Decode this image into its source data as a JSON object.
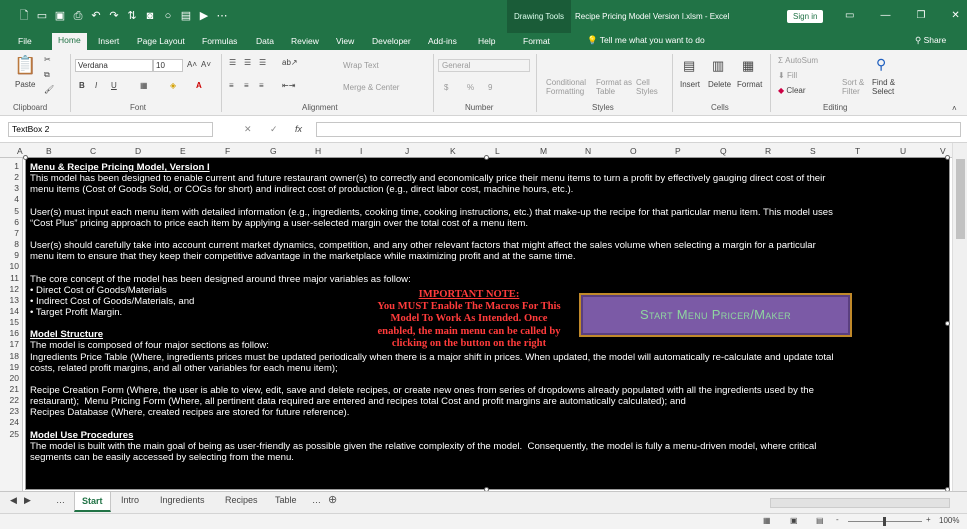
{
  "titlebar": {
    "drawing_tools": "Drawing Tools",
    "doc_title": "Recipe Pricing Model Version I.xlsm  -  Excel",
    "sign_in": "Sign in"
  },
  "tabs": [
    "File",
    "Home",
    "Insert",
    "Page Layout",
    "Formulas",
    "Data",
    "Review",
    "View",
    "Developer",
    "Add-ins",
    "Help",
    "Format"
  ],
  "tell_me": "Tell me what you want to do",
  "share": "Share",
  "ribbon": {
    "clipboard": {
      "paste": "Paste",
      "label": "Clipboard"
    },
    "font": {
      "name": "Verdana",
      "size": "10",
      "label": "Font",
      "bold": "B",
      "italic": "I",
      "underline": "U"
    },
    "alignment": {
      "wrap": "Wrap Text",
      "merge": "Merge & Center",
      "label": "Alignment"
    },
    "number": {
      "format": "General",
      "currency": "$",
      "percent": "%",
      "comma": "9",
      "label": "Number"
    },
    "styles": {
      "conditional": "Conditional",
      "formatting": "Formatting",
      "format_as": "Format as",
      "table": "Table",
      "cell": "Cell",
      "styles_btn": "Styles",
      "label": "Styles"
    },
    "cells": {
      "insert": "Insert",
      "delete": "Delete",
      "format": "Format",
      "label": "Cells"
    },
    "editing": {
      "autosum": "AutoSum",
      "fill": "Fill",
      "clear": "Clear",
      "sort": "Sort &",
      "filter": "Filter",
      "find": "Find &",
      "select": "Select",
      "label": "Editing"
    }
  },
  "formula_bar": {
    "name_box": "TextBox 2",
    "fx": "fx"
  },
  "columns": [
    "A",
    "B",
    "C",
    "D",
    "E",
    "F",
    "G",
    "H",
    "I",
    "J",
    "K",
    "L",
    "M",
    "N",
    "O",
    "P",
    "Q",
    "R",
    "S",
    "T",
    "U",
    "V"
  ],
  "rows": [
    "1",
    "2",
    "3",
    "4",
    "5",
    "6",
    "7",
    "8",
    "9",
    "10",
    "11",
    "12",
    "13",
    "14",
    "15",
    "16",
    "17",
    "18",
    "19",
    "20",
    "21",
    "22",
    "23",
    "24",
    "25"
  ],
  "textbox": {
    "lines": [
      "Menu & Recipe Pricing Model, Version I",
      "This model has been designed to enable current and future restaurant owner(s) to correctly and economically price their menu items to turn a profit by effectively gauging direct cost of their",
      "menu items (Cost of Goods Sold, or COGs for short) and indirect cost of production (e.g., direct labor cost, machine hours, etc.).",
      "",
      "User(s) must input each menu item with detailed information (e.g., ingredients, cooking time, cooking instructions, etc.) that make-up the recipe for that particular menu item. This model uses",
      "“Cost Plus” pricing approach to price each item by applying a user-selected margin over the total cost of a menu item.",
      "",
      "User(s) should carefully take into account current market dynamics, competition, and any other relevant factors that might affect the sales volume when selecting a margin for a particular",
      "menu item to ensure that they keep their competitive advantage in the marketplace while maximizing profit and at the same time.",
      "",
      "The core concept of the model has been designed around three major variables as follow:",
      "• Direct Cost of Goods/Materials",
      "• Indirect Cost of Goods/Materials, and",
      "• Target Profit Margin.",
      "",
      "Model Structure",
      "The model is composed of four major sections as follow:",
      "Ingredients Price Table (Where, ingredients prices must be updated periodically when there is a major shift in prices. When updated, the model will automatically re-calculate and update total",
      "costs, related profit margins, and all other variables for each menu item);",
      "",
      "Recipe Creation Form (Where, the user is able to view, edit, save and delete recipes, or create new ones from series of dropdowns already populated with all the ingredients used by the",
      "restaurant);  Menu Pricing Form (Where, all pertinent data required are entered and recipes total Cost and profit margins are automatically calculated); and",
      "Recipes Database (Where, created recipes are stored for future reference).",
      "",
      "Model Use Procedures",
      "The model is built with the main goal of being as user-friendly as possible given the relative complexity of the model.  Consequently, the model is fully a menu-driven model, where critical",
      "segments can be easily accessed by selecting from the menu."
    ],
    "note_title": "IMPORTANT NOTE:",
    "note_lines": [
      "You MUST Enable The Macros For This",
      "Model To Work As Intended.  Once",
      "enabled, the main menu can be called by",
      "clicking on the button on the right"
    ],
    "start_button": "Start Menu Pricer/Maker"
  },
  "sheet_tabs": [
    "Start",
    "Intro",
    "Ingredients",
    "Recipes",
    "Table"
  ],
  "status": {
    "zoom": "100%",
    "minus": "-",
    "plus": "+"
  }
}
